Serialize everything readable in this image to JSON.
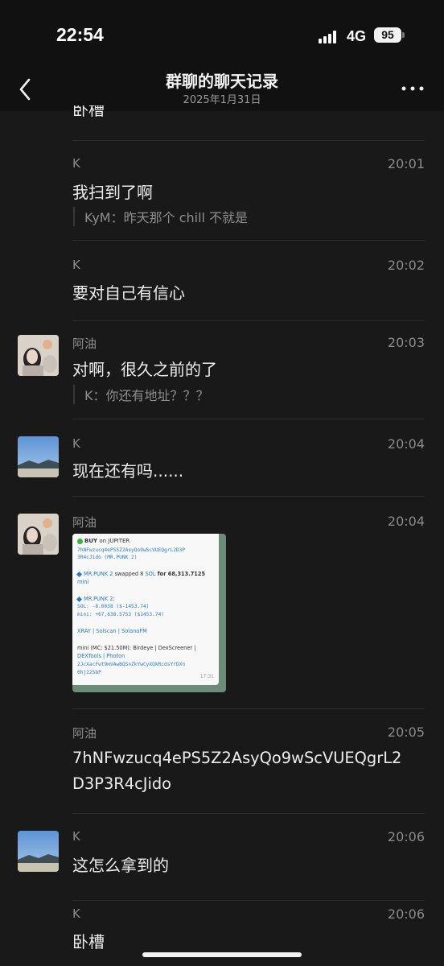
{
  "status_bar": {
    "time": "22:54",
    "network": "4G",
    "battery": "95"
  },
  "nav": {
    "title": "群聊的聊天记录",
    "subtitle": "2025年1月31日"
  },
  "partial_top_text": "卧槽",
  "messages": [
    {
      "sender": "K",
      "time": "20:01",
      "text": "我扫到了啊",
      "quote": "KyM：昨天那个 chill 不就是"
    },
    {
      "sender": "K",
      "time": "20:02",
      "text": "要对自己有信心"
    },
    {
      "sender": "阿油",
      "time": "20:03",
      "text": "对啊，很久之前的了",
      "quote": "K：你还有地址？？？"
    },
    {
      "sender": "K",
      "time": "20:04",
      "text": "现在还有吗......"
    },
    {
      "sender": "阿油",
      "time": "20:04"
    },
    {
      "sender": "阿油",
      "time": "20:05",
      "text_line1": "7hNFwzucq4ePS5Z2AsyQo9wScVUEQgrL2",
      "text_line2": "D3P3R4cJido"
    },
    {
      "sender": "K",
      "time": "20:06",
      "text": "这怎么拿到的"
    },
    {
      "sender": "K",
      "time": "20:06",
      "text": "卧槽"
    }
  ],
  "image_card": {
    "l1_buy": "BUY",
    "l1_on": " on JUPITER",
    "l2": "7hNFwzucq4ePS5Z2AsyQo9wScVUEQgrL2D3P",
    "l3": "3R4cJido (MR.PUNK 2)",
    "l4a": "MR.PUNK 2",
    "l4b": " swapped 8 ",
    "l4c": "SOL",
    "l4d": " for 68,313.7125",
    "l5": "mini",
    "l6": "MR.PUNK 2:",
    "l7": "SOL: -8.0038 ($-1453.74)",
    "l8": "mini: +67,638.5753 ($1453.74)",
    "l9": "XRAY | Solscan | SolanaFM",
    "l10": "mini (MC: $21.50M): Birdeye | DexScreener |",
    "l11": "DEXTools | Photon",
    "l12": "2JcXacFwt9mVAwBQSnZkYwCyXQkRcdsYrDXn",
    "l13": "6hj22SbP",
    "timestamp": "17:31"
  },
  "colors": {
    "background": "#191919",
    "header": "#111111",
    "link": "#2b7bbf"
  },
  "icons": {
    "back": "chevron-left-icon",
    "more": "more-dots-icon"
  }
}
